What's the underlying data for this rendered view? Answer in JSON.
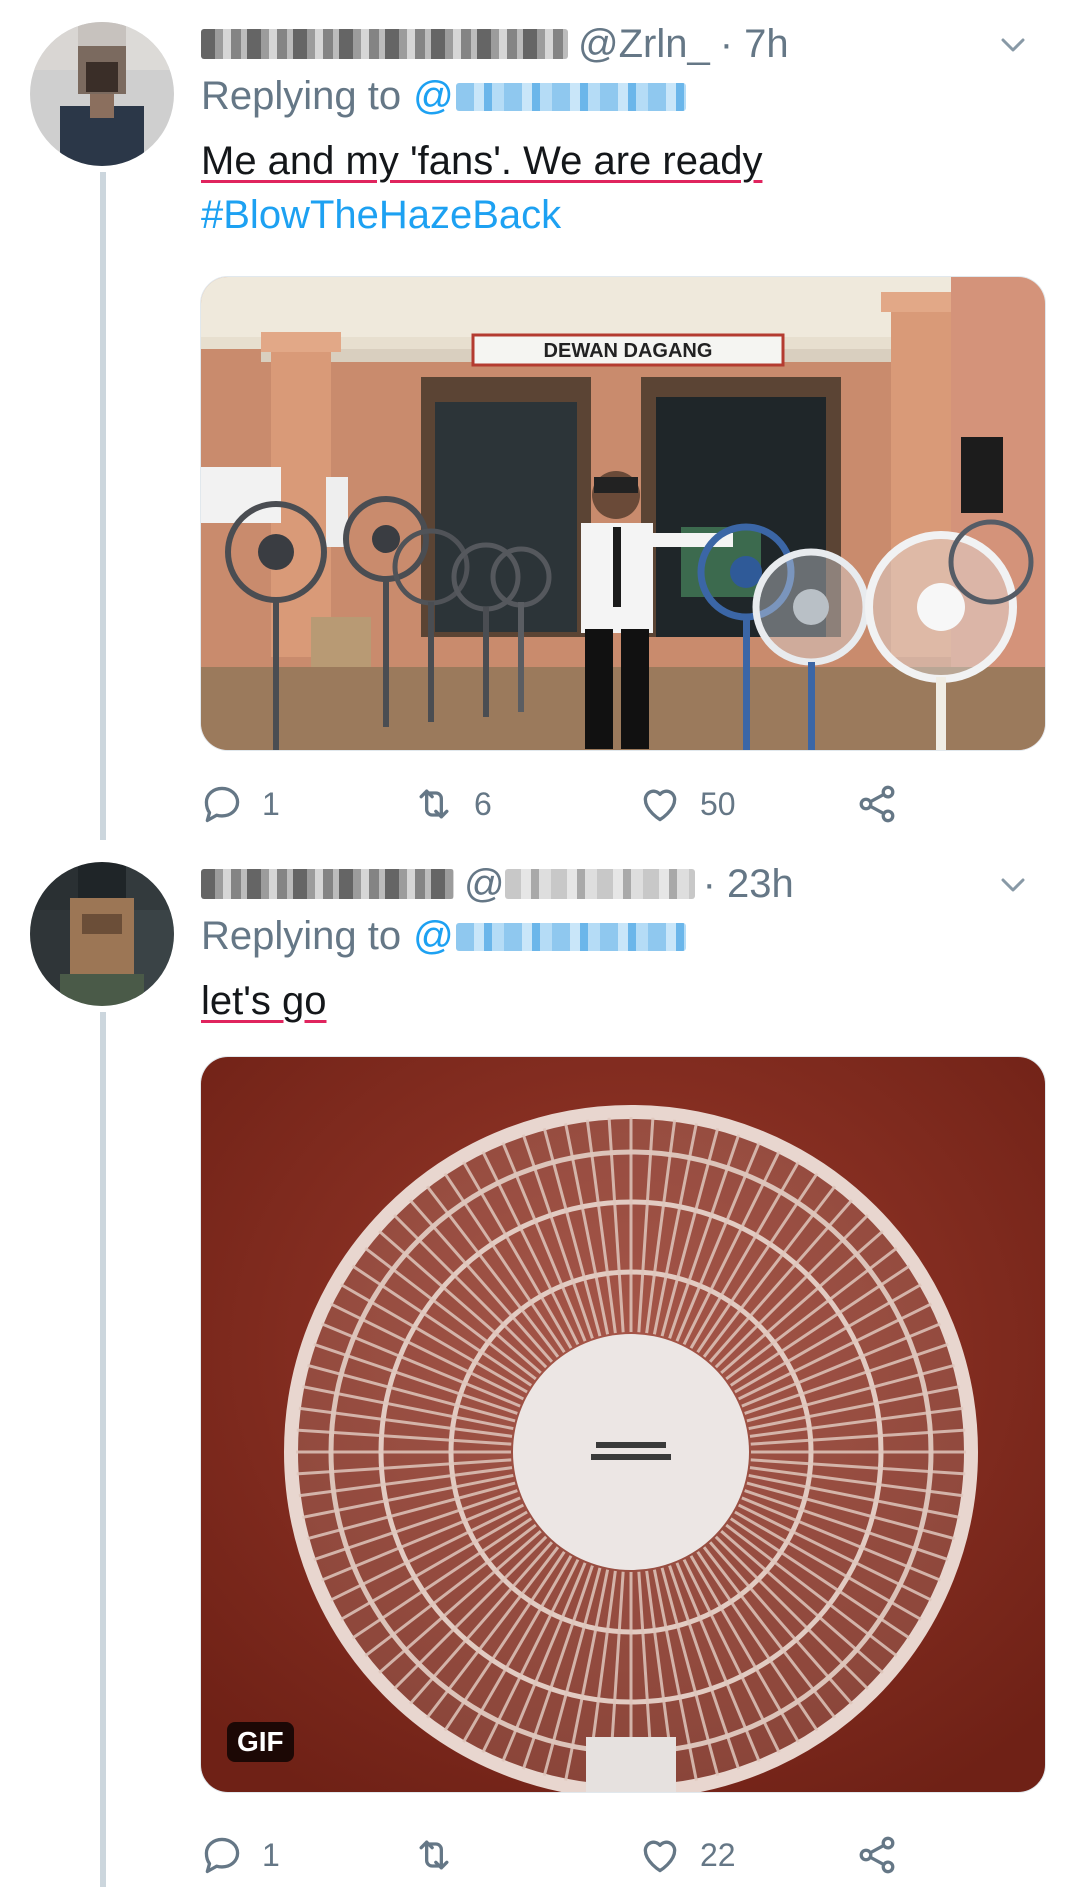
{
  "tweets": [
    {
      "handle": "@Zrln_",
      "time": "· 7h",
      "replying_to": "Replying to",
      "replying_at": "@",
      "text": "Me and my 'fans'. We are ready",
      "hashtag": "#BlowTheHazeBack",
      "media": {
        "sign_text": "DEWAN DAGANG"
      },
      "actions": {
        "reply_count": "1",
        "retweet_count": "6",
        "like_count": "50"
      }
    },
    {
      "handle_at": "@",
      "time": "· 23h",
      "replying_to": "Replying to",
      "replying_at": "@",
      "text": "let's go",
      "media": {
        "badge": "GIF"
      },
      "actions": {
        "reply_count": "1",
        "retweet_count": "",
        "like_count": "22"
      }
    }
  ],
  "colors": {
    "link": "#1da1f2",
    "muted": "#657786",
    "text": "#14171a",
    "thread_line": "#ccd6dd"
  },
  "icons": [
    "avatar",
    "chevron-down-icon",
    "reply-icon",
    "retweet-icon",
    "like-icon",
    "share-icon"
  ]
}
